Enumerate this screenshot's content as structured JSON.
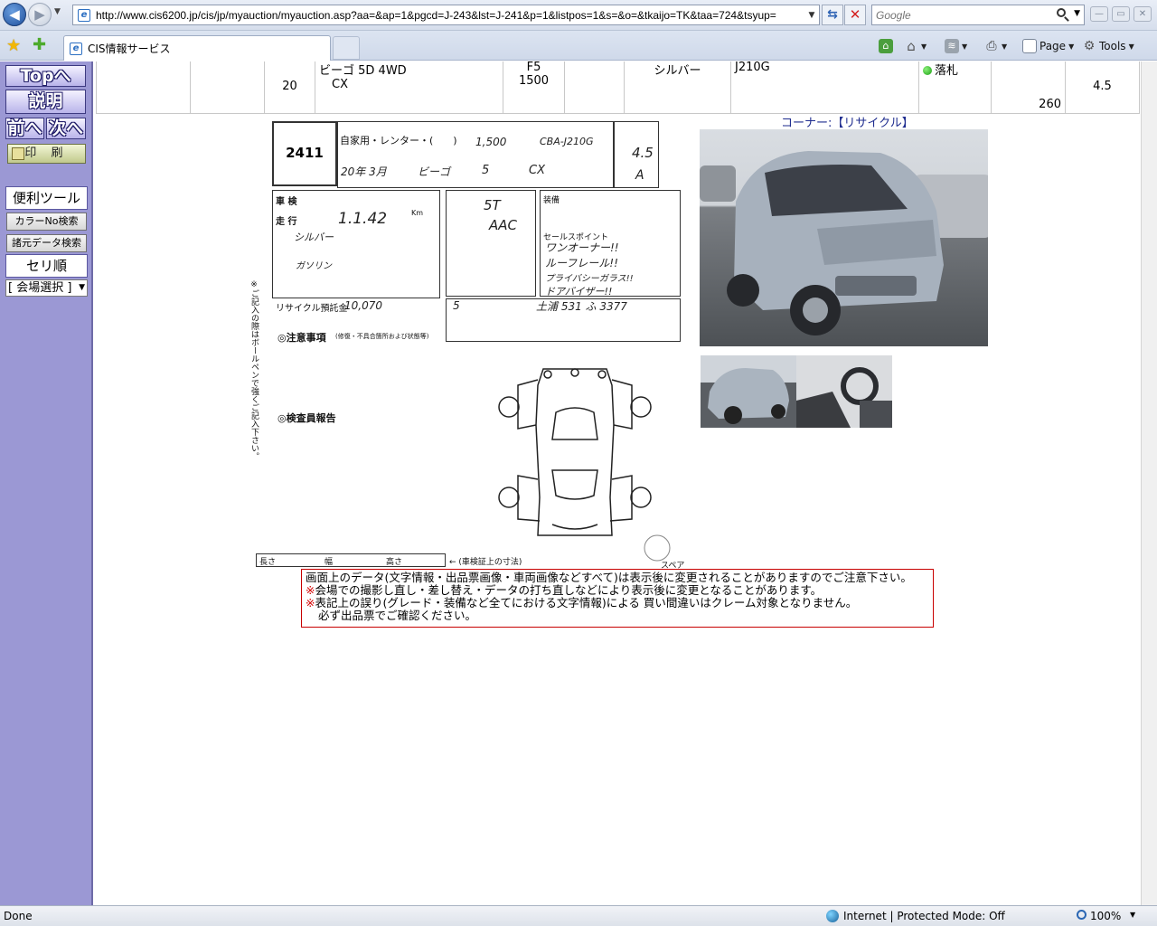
{
  "browser": {
    "url": "http://www.cis6200.jp/cis/jp/myauction/myauction.asp?aa=&ap=1&pgcd=J-243&lst=J-241&p=1&listpos=1&s=&o=&tkaijo=TK&taa=724&tsyup=",
    "search_placeholder": "Google",
    "tab_title": "CIS情報サービス",
    "commands": {
      "page": "Page",
      "tools": "Tools"
    },
    "status": "Done",
    "zone": "Internet | Protected Mode: Off",
    "zoom": "100%"
  },
  "sidebar": {
    "top": "Topへ",
    "help": "説明",
    "prev": "前へ",
    "next": "次へ",
    "print": "印 刷",
    "tools_header": "便利ツール",
    "color_search": "カラーNo検索",
    "spec_search": "諸元データ検索",
    "sort_header": "セリ順",
    "venue_select": "[ 会場選択 ]"
  },
  "lot": {
    "year": "20",
    "model": "ビーゴ 5D 4WD",
    "grade": "CX",
    "shift": "F5",
    "displacement": "1500",
    "color": "シルバー",
    "model_code": "J210G",
    "result": "落札",
    "price": "260",
    "score": "4.5"
  },
  "sheet": {
    "lot_no": "2411",
    "usage": "自家用・レンター・(　　)",
    "cc": "1,500",
    "type_code": "CBA-J210G",
    "grade_score": "4.5",
    "interior": "A",
    "first_reg": "20年 3月",
    "car_name": "ビーゴ",
    "doors": "5",
    "grade": "CX",
    "odometer": "1.1.42",
    "shift": "5T",
    "aircon": "AAC",
    "color": "シルバー",
    "fuel": "ガソリン",
    "recycle_fee": "10,070",
    "plate": "土浦 531 ふ 3377",
    "capacity": "5",
    "sales_points": [
      "ワンオーナー!!",
      "ルーフレール!!",
      "プライバシーガラス!!",
      "ドアバイザー!!"
    ],
    "labels": {
      "inspection": "車 検",
      "mileage": "走 行",
      "km": "Km",
      "notes": "◎注意事項",
      "notes_sub": "(修復・不具合箇所および状態等)",
      "inspector": "◎検査員報告",
      "length": "長さ",
      "width": "幅",
      "height": "高さ",
      "dims_note": "← (車検証上の寸法)",
      "spare": "スペア",
      "recycle": "リサイクル預託金",
      "sales_point": "セールスポイント",
      "equipment": "装備",
      "vertical_note": "※ご記入の際はボールペンで強くご記入下さい。"
    }
  },
  "photos": {
    "corner": "コーナー:【リサイクル】"
  },
  "notice": {
    "line1": "画面上のデータ(文字情報・出品票画像・車両画像などすべて)は表示後に変更されることがありますのでご注意下さい。",
    "line2": "会場での撮影し直し・差し替え・データの打ち直しなどにより表示後に変更となることがあります。",
    "line3": "表記上の誤り(グレード・装備など全てにおける文字情報)による 買い間違いはクレーム対象となりません。",
    "line4": "必ず出品票でご確認ください。",
    "mark": "※"
  }
}
